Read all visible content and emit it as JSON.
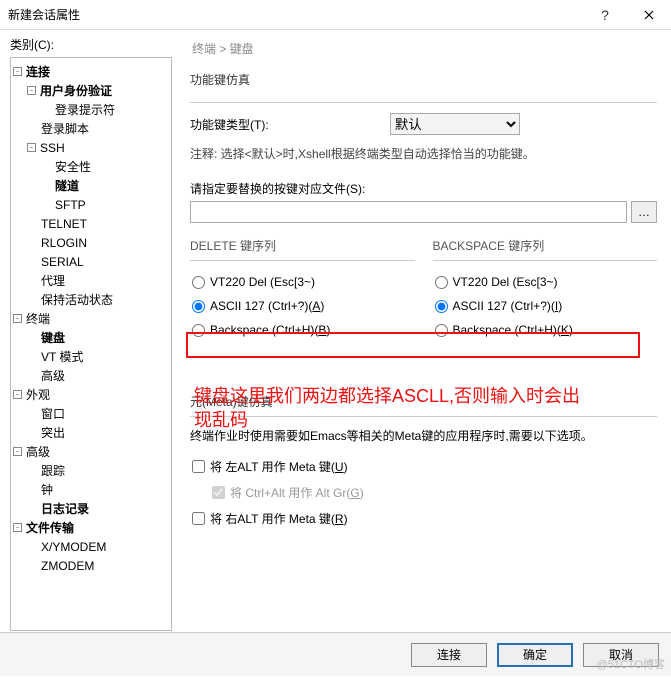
{
  "titlebar": {
    "title": "新建会话属性"
  },
  "left": {
    "category_label": "类别(C):",
    "tree": [
      {
        "indent": 0,
        "label": "连接",
        "bold": true,
        "expander": "-"
      },
      {
        "indent": 1,
        "label": "用户身份验证",
        "bold": true,
        "expander": "-"
      },
      {
        "indent": 2,
        "label": "登录提示符",
        "bold": false,
        "expander": ""
      },
      {
        "indent": 1,
        "label": "登录脚本",
        "bold": false,
        "expander": ""
      },
      {
        "indent": 1,
        "label": "SSH",
        "bold": false,
        "expander": "-"
      },
      {
        "indent": 2,
        "label": "安全性",
        "bold": false,
        "expander": ""
      },
      {
        "indent": 2,
        "label": "隧道",
        "bold": true,
        "expander": ""
      },
      {
        "indent": 2,
        "label": "SFTP",
        "bold": false,
        "expander": ""
      },
      {
        "indent": 1,
        "label": "TELNET",
        "bold": false,
        "expander": ""
      },
      {
        "indent": 1,
        "label": "RLOGIN",
        "bold": false,
        "expander": ""
      },
      {
        "indent": 1,
        "label": "SERIAL",
        "bold": false,
        "expander": ""
      },
      {
        "indent": 1,
        "label": "代理",
        "bold": false,
        "expander": ""
      },
      {
        "indent": 1,
        "label": "保持活动状态",
        "bold": false,
        "expander": ""
      },
      {
        "indent": 0,
        "label": "终端",
        "bold": false,
        "expander": "-"
      },
      {
        "indent": 1,
        "label": "键盘",
        "bold": true,
        "expander": ""
      },
      {
        "indent": 1,
        "label": "VT 模式",
        "bold": false,
        "expander": ""
      },
      {
        "indent": 1,
        "label": "高级",
        "bold": false,
        "expander": ""
      },
      {
        "indent": 0,
        "label": "外观",
        "bold": false,
        "expander": "-"
      },
      {
        "indent": 1,
        "label": "窗口",
        "bold": false,
        "expander": ""
      },
      {
        "indent": 1,
        "label": "突出",
        "bold": false,
        "expander": ""
      },
      {
        "indent": 0,
        "label": "高级",
        "bold": false,
        "expander": "-"
      },
      {
        "indent": 1,
        "label": "跟踪",
        "bold": false,
        "expander": ""
      },
      {
        "indent": 1,
        "label": "钟",
        "bold": false,
        "expander": ""
      },
      {
        "indent": 1,
        "label": "日志记录",
        "bold": true,
        "expander": ""
      },
      {
        "indent": 0,
        "label": "文件传输",
        "bold": true,
        "expander": "-"
      },
      {
        "indent": 1,
        "label": "X/YMODEM",
        "bold": false,
        "expander": ""
      },
      {
        "indent": 1,
        "label": "ZMODEM",
        "bold": false,
        "expander": ""
      }
    ]
  },
  "right": {
    "breadcrumb": "终端 > 键盘",
    "funcKey": {
      "section": "功能键仿真",
      "type_label": "功能键类型(T):",
      "type_value": "默认",
      "note": "注释: 选择<默认>时,Xshell根据终端类型自动选择恰当的功能键。"
    },
    "replace": {
      "label": "请指定要替换的按键对应文件(S):",
      "value": "",
      "browse": "…"
    },
    "delete": {
      "title": "DELETE 键序列",
      "opt1": "VT220 Del (Esc[3~)",
      "opt2_pre": "ASCII 127 (Ctrl+?)(",
      "opt2_mn": "A",
      "opt2_post": ")",
      "opt3_pre": "Backspace (Ctrl+H)(",
      "opt3_mn": "B",
      "opt3_post": ")"
    },
    "backspace": {
      "title": "BACKSPACE 键序列",
      "opt1": "VT220 Del (Esc[3~)",
      "opt2_pre": "ASCII 127 (Ctrl+?)(",
      "opt2_mn": "I",
      "opt2_post": ")",
      "opt3_pre": "Backspace (Ctrl+H)(",
      "opt3_mn": "K",
      "opt3_post": ")"
    },
    "annotation_line1": "键盘这里我们两边都选择ASCLL,否则输入时会出",
    "annotation_line2": "现乱码",
    "meta": {
      "section": "元(Meta)键仿真",
      "note": "终端作业时使用需要如Emacs等相关的Meta键的应用程序时,需要以下选项。",
      "left_alt_pre": "将 左ALT 用作 Meta 键(",
      "left_alt_mn": "U",
      "left_alt_post": ")",
      "ctrl_alt_pre": "将 Ctrl+Alt 用作 Alt Gr(",
      "ctrl_alt_mn": "G",
      "ctrl_alt_post": ")",
      "right_alt_pre": "将 右ALT 用作 Meta 键(",
      "right_alt_mn": "R",
      "right_alt_post": ")"
    }
  },
  "footer": {
    "connect": "连接",
    "ok": "确定",
    "cancel": "取消"
  },
  "watermark": "@51CTO博客"
}
